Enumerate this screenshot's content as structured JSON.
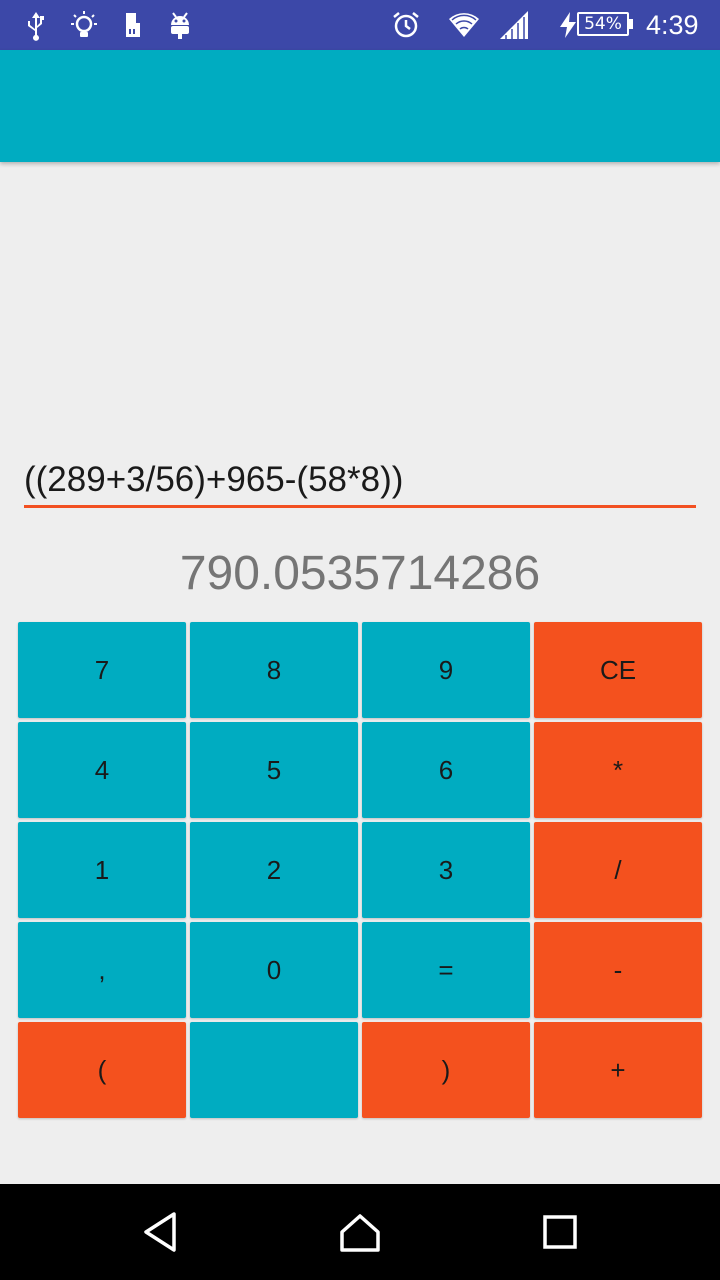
{
  "status_bar": {
    "icons": [
      "usb-icon",
      "lightbulb-icon",
      "sd-card-icon",
      "android-icon",
      "alarm-icon",
      "wifi-icon",
      "signal-icon",
      "charging-icon"
    ],
    "battery": "54%",
    "time": "4:39",
    "background": "#3c48a8"
  },
  "app_bar": {
    "color": "#00acc1"
  },
  "display": {
    "expression": "((289+3/56)+965-(58*8))",
    "result": "790.0535714286",
    "underline_color": "#f25022"
  },
  "keypad": {
    "colors": {
      "digit": "#00acc1",
      "operator": "#f4511e"
    },
    "keys": [
      {
        "label": "7",
        "kind": "digit"
      },
      {
        "label": "8",
        "kind": "digit"
      },
      {
        "label": "9",
        "kind": "digit"
      },
      {
        "label": "CE",
        "kind": "operator"
      },
      {
        "label": "4",
        "kind": "digit"
      },
      {
        "label": "5",
        "kind": "digit"
      },
      {
        "label": "6",
        "kind": "digit"
      },
      {
        "label": "*",
        "kind": "operator"
      },
      {
        "label": "1",
        "kind": "digit"
      },
      {
        "label": "2",
        "kind": "digit"
      },
      {
        "label": "3",
        "kind": "digit"
      },
      {
        "label": "/",
        "kind": "operator"
      },
      {
        "label": ",",
        "kind": "digit"
      },
      {
        "label": "0",
        "kind": "digit"
      },
      {
        "label": "=",
        "kind": "digit"
      },
      {
        "label": "-",
        "kind": "operator"
      },
      {
        "label": "(",
        "kind": "operator"
      },
      {
        "label": "",
        "kind": "digit"
      },
      {
        "label": ")",
        "kind": "operator"
      },
      {
        "label": "+",
        "kind": "operator"
      }
    ]
  },
  "nav_bar": {
    "buttons": [
      "back-icon",
      "home-icon",
      "recents-icon"
    ]
  }
}
